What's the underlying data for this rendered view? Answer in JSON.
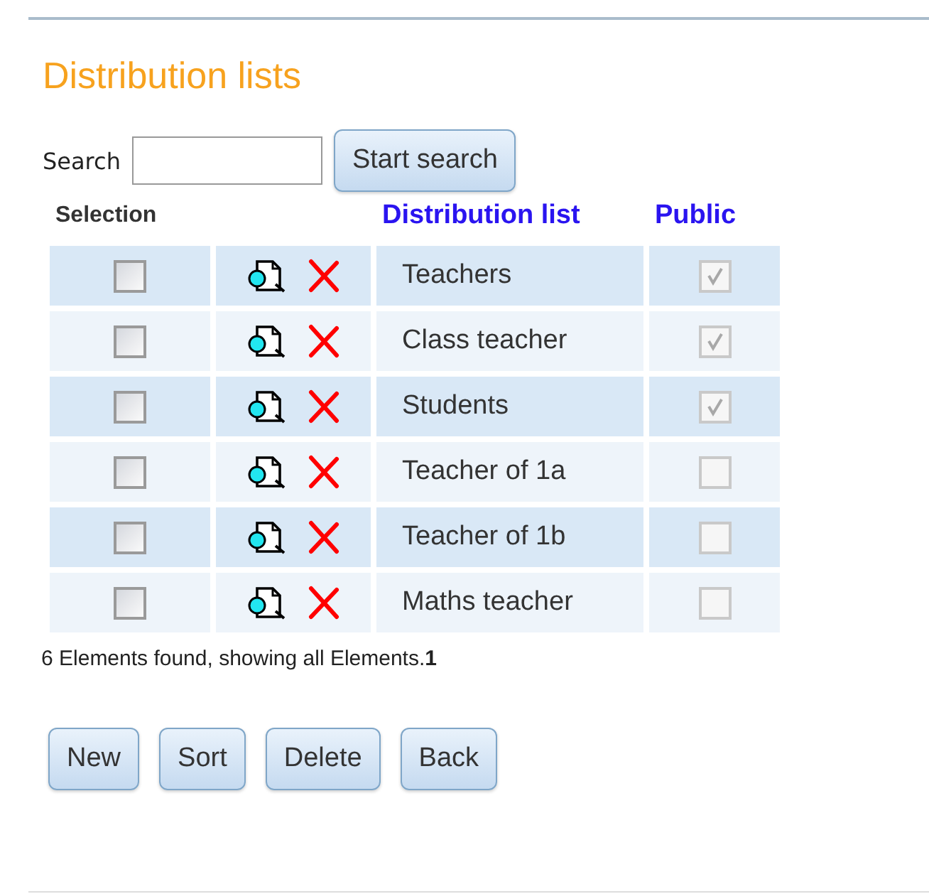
{
  "title": "Distribution lists",
  "search": {
    "label": "Search",
    "button": "Start search"
  },
  "table": {
    "columns": [
      {
        "label": "Selection",
        "kind": "plain"
      },
      {
        "kind": "plain"
      },
      {
        "label": "Distribution list",
        "kind": "link"
      },
      {
        "label": "Public",
        "kind": "link"
      }
    ],
    "rows": [
      {
        "checked": false,
        "name": "Teachers",
        "public": true
      },
      {
        "checked": false,
        "name": "Class teacher",
        "public": true
      },
      {
        "checked": false,
        "name": "Students",
        "public": true
      },
      {
        "checked": false,
        "name": "Teacher of 1a",
        "public": false
      },
      {
        "checked": false,
        "name": "Teacher of 1b",
        "public": false
      },
      {
        "checked": false,
        "name": "Maths teacher",
        "public": false
      }
    ]
  },
  "status": "6 Elements found, showing all Elements.**1**",
  "buttons": [
    "New",
    "Sort",
    "Delete",
    "Back"
  ]
}
